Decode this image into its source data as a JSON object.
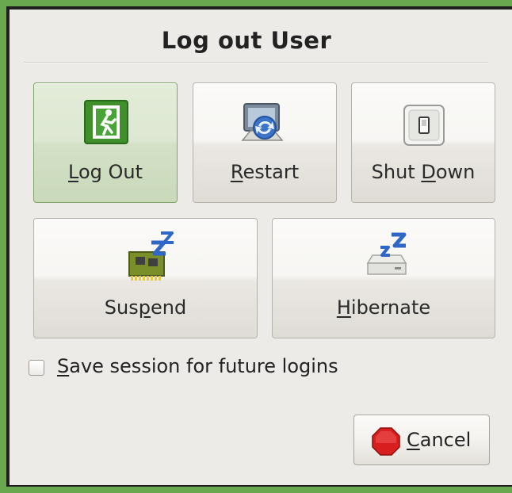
{
  "dialog": {
    "title": "Log out User"
  },
  "buttons": {
    "logout": {
      "pre": "",
      "mnemonic": "L",
      "post": "og Out",
      "icon": "exit-door-icon"
    },
    "restart": {
      "pre": "",
      "mnemonic": "R",
      "post": "estart",
      "icon": "restart-icon"
    },
    "shutdown": {
      "pre": "Shut ",
      "mnemonic": "D",
      "post": "own",
      "icon": "power-switch-icon"
    },
    "suspend": {
      "pre": "Sus",
      "mnemonic": "p",
      "post": "end",
      "icon": "suspend-chip-icon"
    },
    "hibernate": {
      "pre": "",
      "mnemonic": "H",
      "post": "ibernate",
      "icon": "hibernate-drive-icon"
    }
  },
  "save_session": {
    "pre": "",
    "mnemonic": "S",
    "post": "ave session for future logins",
    "checked": false
  },
  "cancel": {
    "pre": "",
    "mnemonic": "C",
    "post": "ancel",
    "icon": "stop-icon"
  },
  "colors": {
    "frame": "#6aa84f",
    "active_button": "#d3e0c6",
    "stop_red": "#d81e1e"
  }
}
